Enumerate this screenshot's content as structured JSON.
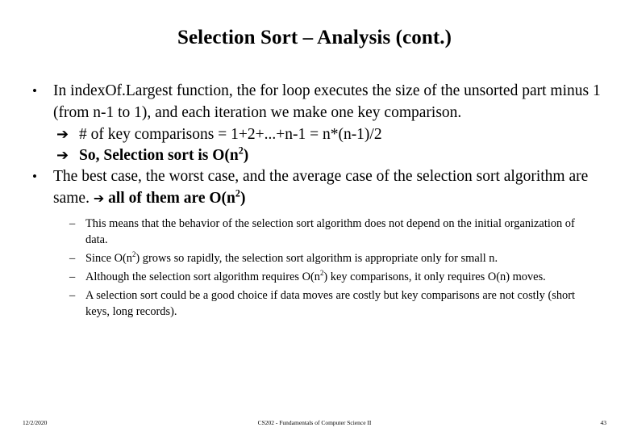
{
  "slide": {
    "title": "Selection Sort – Analysis (cont.)",
    "bullets": [
      {
        "marker": "•",
        "text": "In indexOf.Largest function, the for loop executes the size of the unsorted part minus 1 (from n-1 to 1), and each iteration we make one key comparison."
      }
    ],
    "arrow_lines": [
      {
        "glyph": "➔",
        "text": "# of key comparisons = 1+2+...+n-1 = n*(n-1)/2",
        "bold": "false"
      },
      {
        "glyph": "➔",
        "text_prefix": "So, Selection sort is O(n",
        "sup": "2",
        "text_suffix": ")",
        "bold": "true"
      }
    ],
    "bullet2": {
      "marker": "•",
      "text_before": "The best case, the worst case, and the average case of the selection sort algorithm are same.",
      "arrow": "➔",
      "text_after_prefix": "all of them are O(n",
      "sup": "2",
      "text_after_suffix": ")"
    },
    "sub_bullets": [
      {
        "marker": "–",
        "text": "This means that the behavior of the selection sort algorithm does not depend on the initial organization of data."
      },
      {
        "marker": "–",
        "text_prefix": "Since O(n",
        "sup": "2",
        "text_suffix": ") grows so rapidly, the selection sort algorithm is appropriate only for small n."
      },
      {
        "marker": "–",
        "text_prefix": "Although the selection sort algorithm requires O(n",
        "sup": "2",
        "text_suffix": ") key comparisons, it only requires O(n) moves."
      },
      {
        "marker": "–",
        "text": "A selection sort could be a good choice if data moves are costly but key comparisons are not costly (short keys, long records)."
      }
    ],
    "footer": {
      "date": "12/2/2020",
      "course": "CS202 - Fundamentals of Computer Science II",
      "page": "43"
    }
  }
}
